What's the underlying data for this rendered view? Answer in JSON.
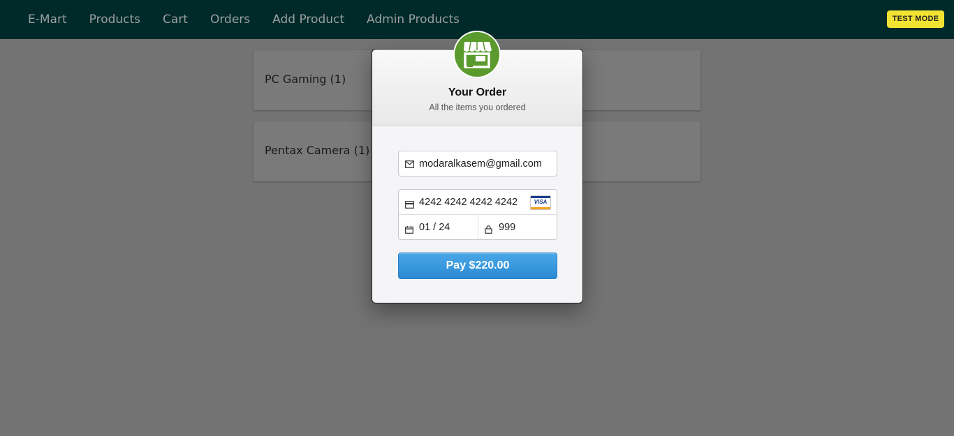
{
  "nav": {
    "items": [
      "E-Mart",
      "Products",
      "Cart",
      "Orders",
      "Add Product",
      "Admin Products"
    ],
    "test_mode_label": "TEST MODE"
  },
  "orders": [
    {
      "label": "PC Gaming (1)"
    },
    {
      "label": "Pentax Camera (1)"
    }
  ],
  "checkout": {
    "title": "Your Order",
    "subtitle": "All the items you ordered",
    "email": "modaralkasem@gmail.com",
    "card_number": "4242 4242 4242 4242",
    "card_brand": "VISA",
    "expiry": "01 / 24",
    "cvc": "999",
    "pay_label": "Pay $220.00",
    "colors": {
      "logo": "#5b9a2c",
      "pay_button": "#2b8ad4",
      "navbar": "#002a2a",
      "test_badge": "#f2e232"
    },
    "icons": [
      "store-logo-icon",
      "mail-icon",
      "credit-card-icon",
      "calendar-icon",
      "lock-icon",
      "visa-icon"
    ]
  }
}
